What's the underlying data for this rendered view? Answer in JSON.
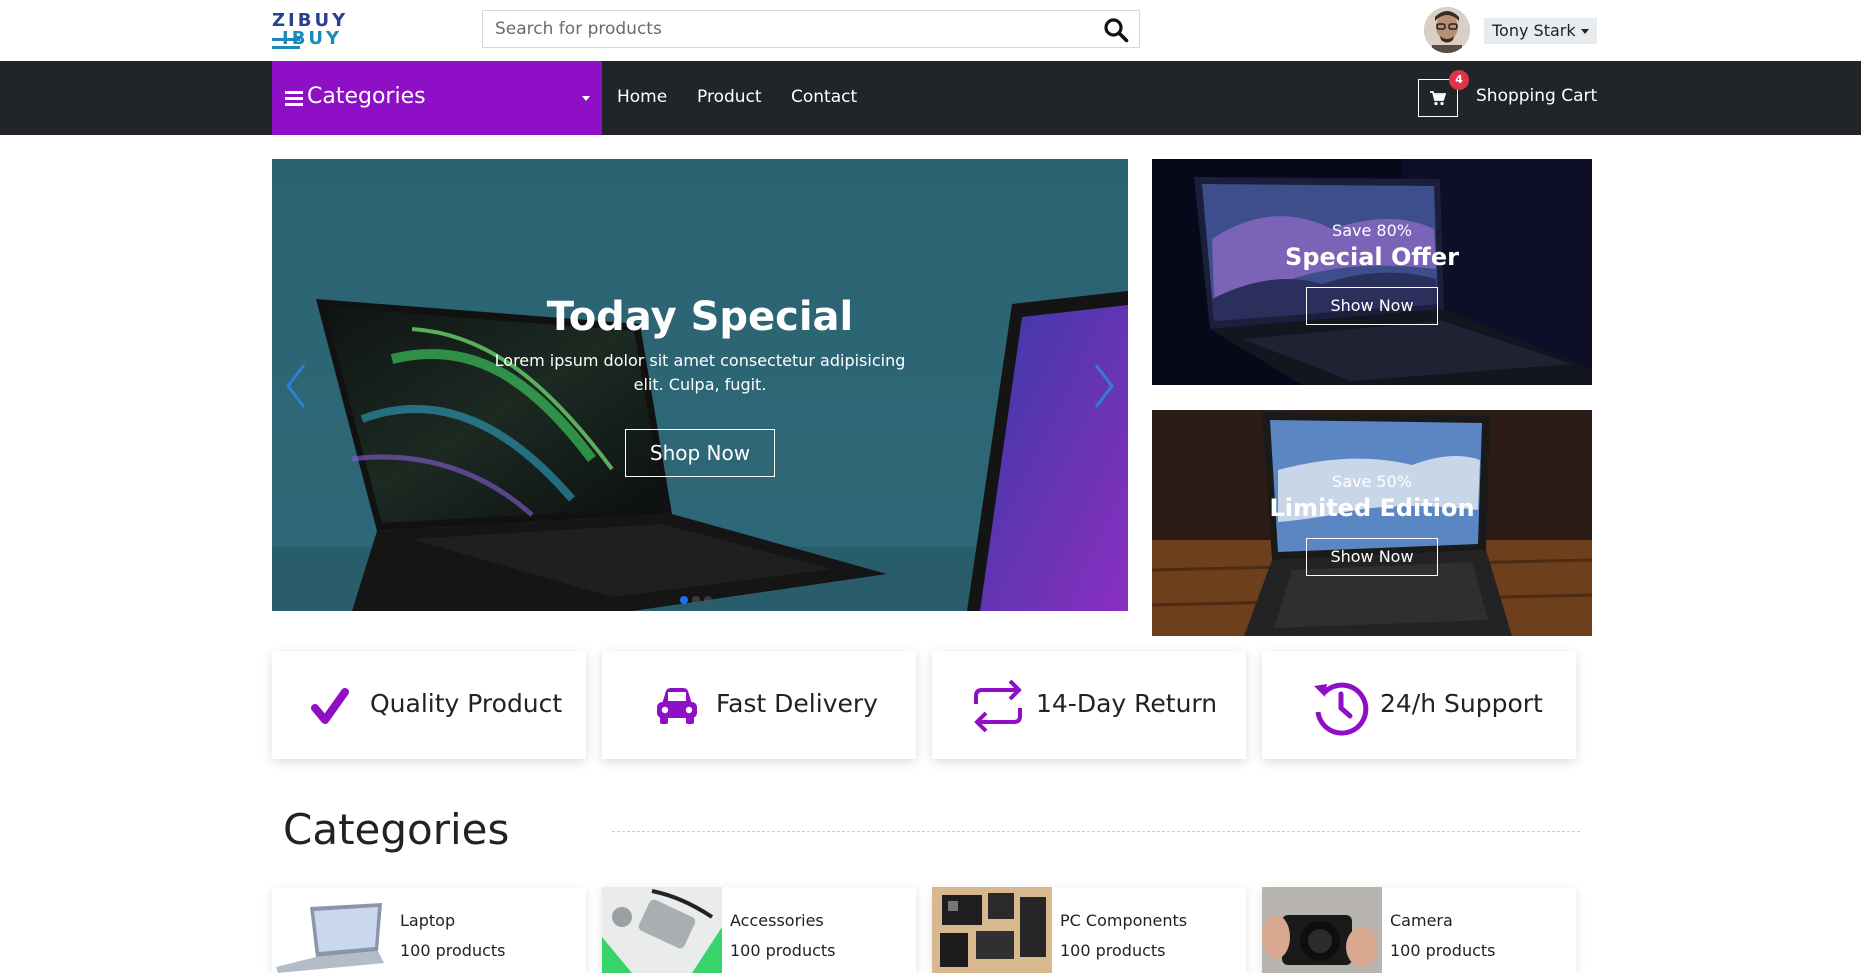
{
  "brand": {
    "logo_line1": "ZIBUY",
    "logo_line2": "IBUY"
  },
  "search": {
    "placeholder": "Search for products"
  },
  "user": {
    "name": "Tony Stark"
  },
  "nav": {
    "categories_label": "Categories",
    "links": [
      "Home",
      "Product",
      "Contact"
    ],
    "cart_count": "4",
    "cart_label": "Shopping Cart"
  },
  "hero": {
    "title": "Today Special",
    "subtitle": "Lorem ipsum dolor sit amet consectetur adipisicing elit. Culpa, fugit.",
    "button": "Shop Now",
    "active_slide": 1,
    "slide_count": 3
  },
  "promos": [
    {
      "save": "Save 80%",
      "title": "Special Offer",
      "button": "Show Now"
    },
    {
      "save": "Save 50%",
      "title": "Limited Edition",
      "button": "Show Now"
    }
  ],
  "features": [
    {
      "label": "Quality Product",
      "icon": "check-icon"
    },
    {
      "label": "Fast Delivery",
      "icon": "car-icon"
    },
    {
      "label": "14-Day Return",
      "icon": "exchange-icon"
    },
    {
      "label": "24/h Support",
      "icon": "history-icon"
    }
  ],
  "categories_heading": "Categories",
  "categories": [
    {
      "name": "Laptop",
      "count": "100 products"
    },
    {
      "name": "Accessories",
      "count": "100 products"
    },
    {
      "name": "PC Components",
      "count": "100 products"
    },
    {
      "name": "Camera",
      "count": "100 products"
    }
  ],
  "colors": {
    "accent": "#8e0fc6",
    "nav_bg": "#212529",
    "badge": "#dc3545"
  }
}
